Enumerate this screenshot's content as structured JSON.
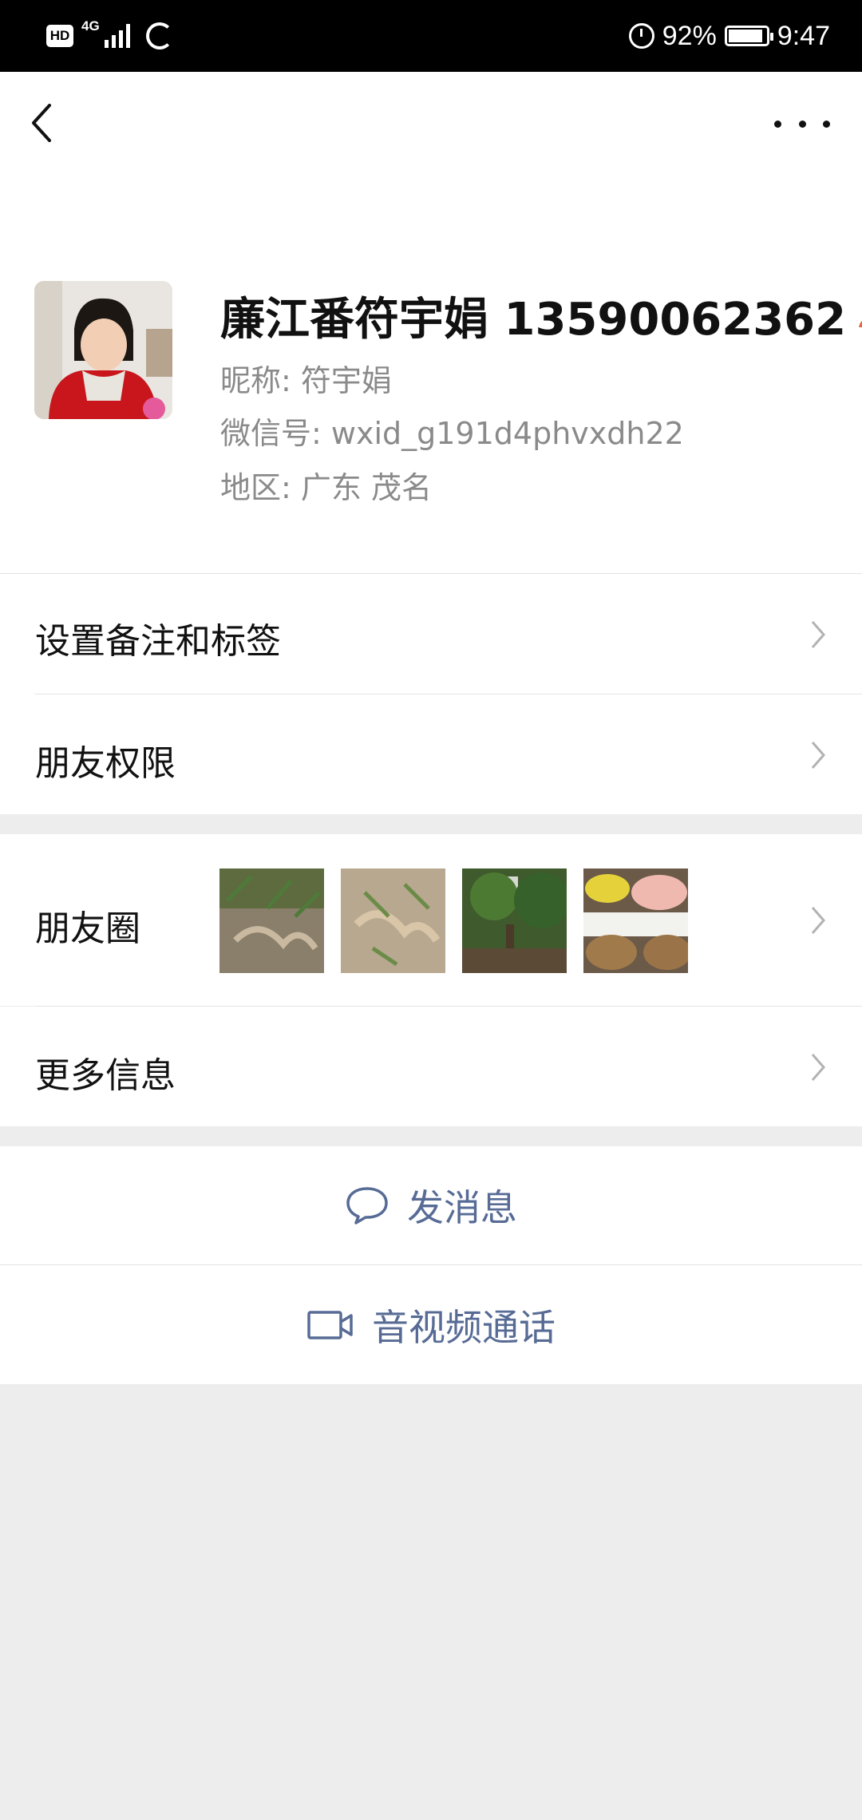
{
  "status_bar": {
    "hd": "HD",
    "network": "4G",
    "battery_pct_text": "92%",
    "battery_level": 0.92,
    "time": "9:47"
  },
  "nav": {
    "back_icon": "chevron-left-icon",
    "more_icon": "ellipsis-icon"
  },
  "profile": {
    "name": "廉江番符宇娟 13590062362",
    "nickname": "昵称:  符宇娟",
    "wechat_id": "微信号:  wxid_g191d4phvxdh22",
    "region": "地区:  广东  茂名"
  },
  "menu": {
    "remark_label": "设置备注和标签",
    "permissions_label": "朋友权限",
    "moments_label": "朋友圈",
    "more_info_label": "更多信息"
  },
  "actions": {
    "message_label": "发消息",
    "call_label": "音视频通话"
  },
  "colors": {
    "link_blue": "#576b95",
    "badge_orange": "#e8643c",
    "background": "#ededed"
  }
}
